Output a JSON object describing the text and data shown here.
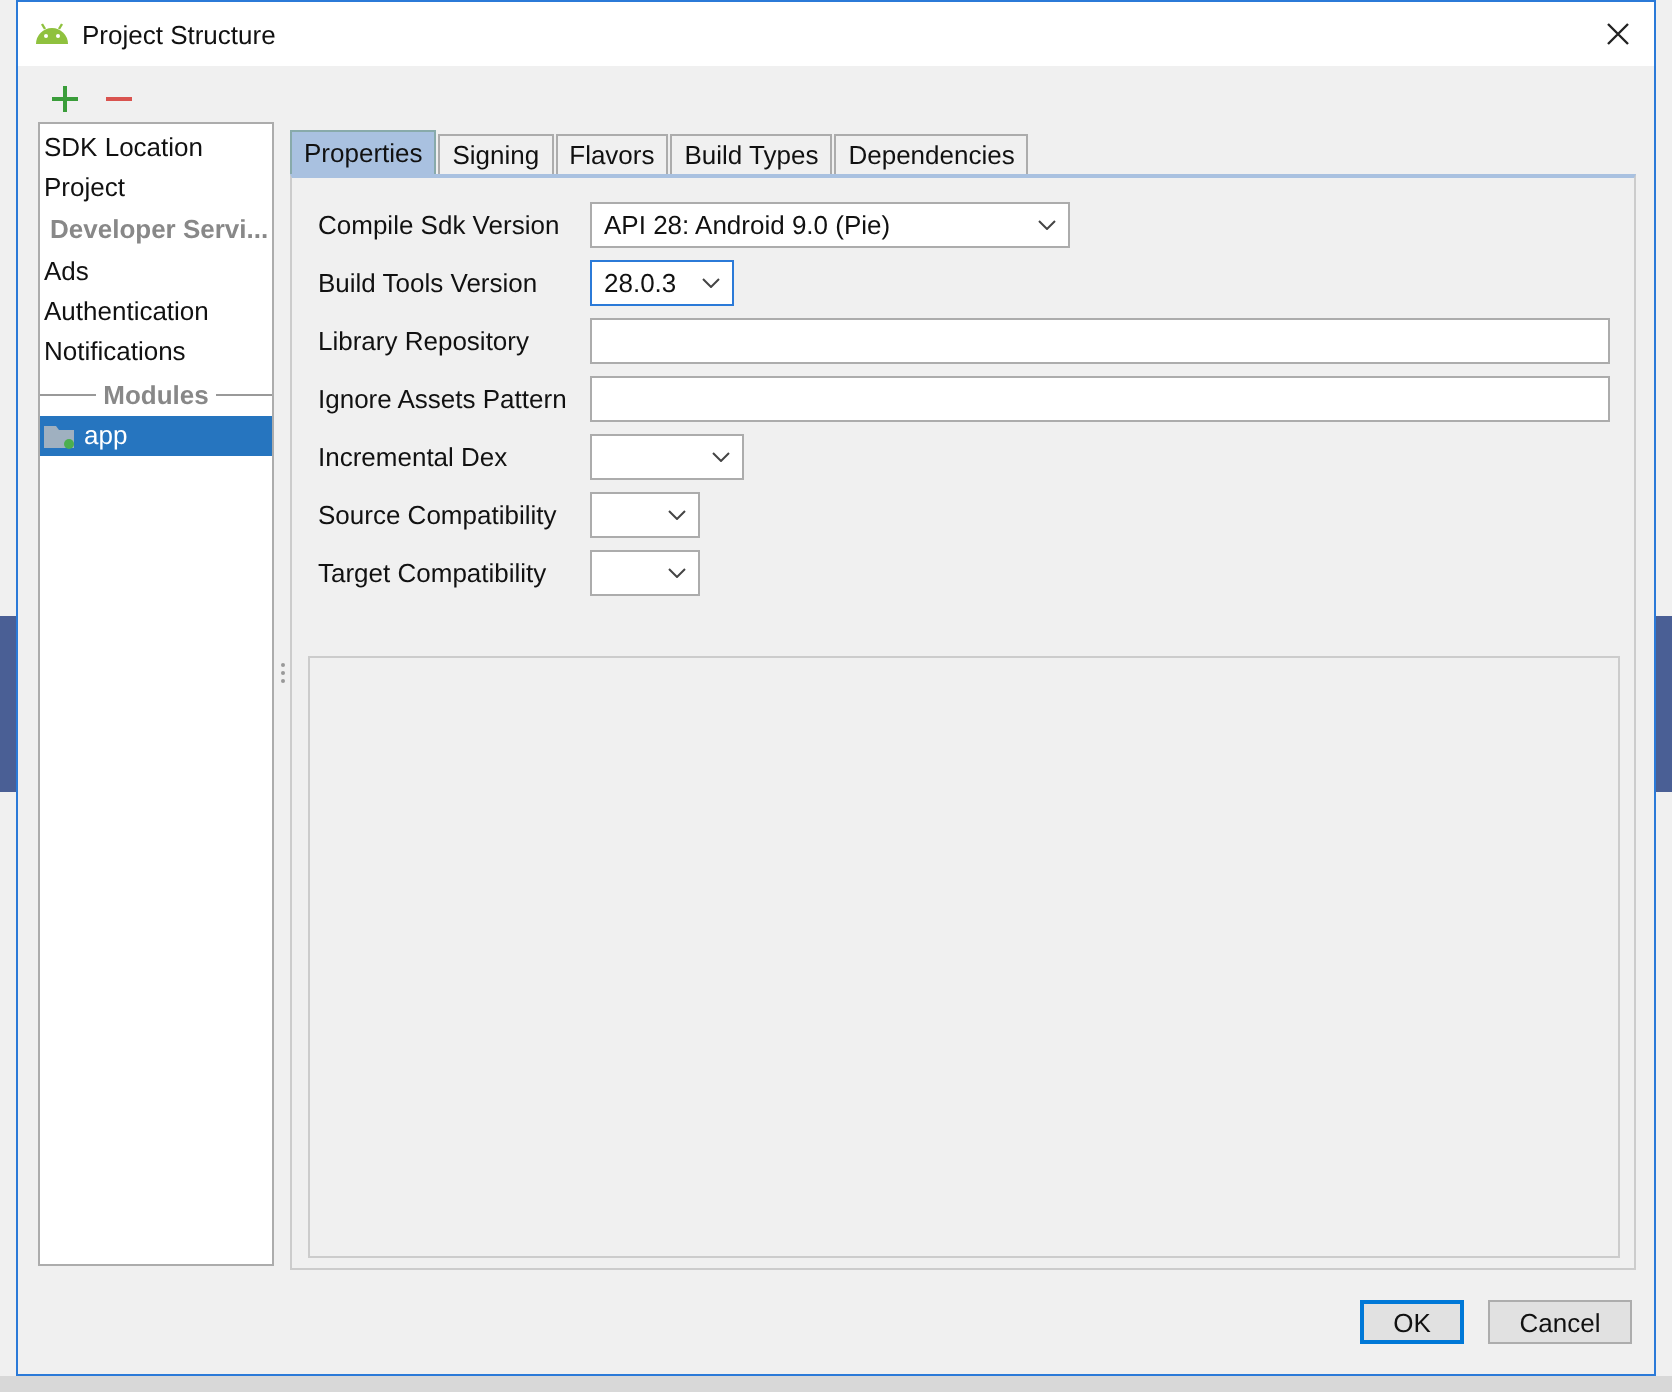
{
  "window": {
    "title": "Project Structure"
  },
  "sidebar": {
    "items": [
      {
        "kind": "item",
        "label": "SDK Location",
        "selected": false
      },
      {
        "kind": "item",
        "label": "Project",
        "selected": false
      },
      {
        "kind": "header",
        "label": "Developer Servi..."
      },
      {
        "kind": "item",
        "label": "Ads",
        "selected": false
      },
      {
        "kind": "item",
        "label": "Authentication",
        "selected": false
      },
      {
        "kind": "item",
        "label": "Notifications",
        "selected": false
      },
      {
        "kind": "section",
        "label": "Modules"
      },
      {
        "kind": "module",
        "label": "app",
        "selected": true
      }
    ]
  },
  "tabs": [
    {
      "label": "Properties",
      "selected": true
    },
    {
      "label": "Signing",
      "selected": false
    },
    {
      "label": "Flavors",
      "selected": false
    },
    {
      "label": "Build Types",
      "selected": false
    },
    {
      "label": "Dependencies",
      "selected": false
    }
  ],
  "fields": [
    {
      "label": "Compile Sdk Version",
      "kind": "dropdown",
      "value": "API 28: Android 9.0 (Pie)",
      "focused": false
    },
    {
      "label": "Build Tools Version",
      "kind": "dropdown",
      "value": "28.0.3",
      "focused": true
    },
    {
      "label": "Library Repository",
      "kind": "text",
      "focused": false
    },
    {
      "label": "Ignore Assets Pattern",
      "kind": "text",
      "focused": false
    },
    {
      "label": "Incremental Dex",
      "kind": "dropdown",
      "focused": false
    },
    {
      "label": "Source Compatibility",
      "kind": "dropdown",
      "focused": false
    },
    {
      "label": "Target Compatibility",
      "kind": "dropdown",
      "focused": false
    }
  ],
  "buttons": [
    {
      "label": "OK",
      "default": true
    },
    {
      "label": "Cancel",
      "default": false
    }
  ]
}
